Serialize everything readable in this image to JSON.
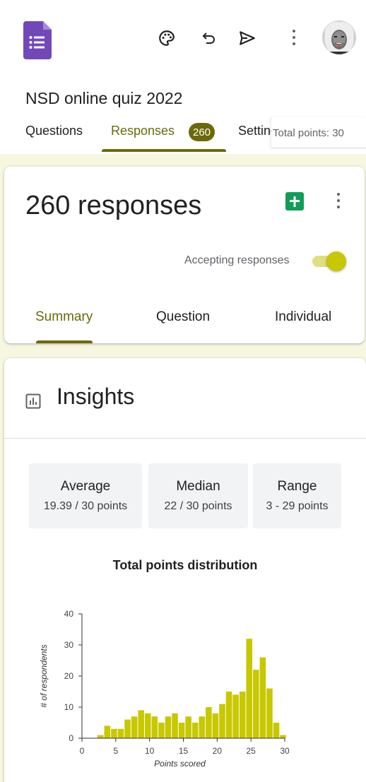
{
  "form": {
    "title": "NSD online quiz 2022"
  },
  "tabs": [
    {
      "label": "Questions"
    },
    {
      "label": "Responses",
      "badge": "260"
    },
    {
      "label": "Settings"
    }
  ],
  "total_points_label": "Total points: 30",
  "header_icons": [
    "palette-icon",
    "undo-icon",
    "send-icon",
    "more-vert-icon"
  ],
  "responses": {
    "count_label": "260 responses",
    "accepting_label": "Accepting responses",
    "accepting": true,
    "subtabs": [
      {
        "label": "Summary"
      },
      {
        "label": "Question"
      },
      {
        "label": "Individual"
      }
    ]
  },
  "insights": {
    "title": "Insights",
    "stats": [
      {
        "label": "Average",
        "value": "19.39 / 30 points"
      },
      {
        "label": "Median",
        "value": "22 / 30 points"
      },
      {
        "label": "Range",
        "value": "3 - 29 points"
      }
    ]
  },
  "colors": {
    "accent": "#6b6a0a",
    "bar": "#c8c800",
    "forms_purple": "#7248b9",
    "sheets_green": "#0f9d58"
  },
  "chart_data": {
    "type": "bar",
    "title": "Total points distribution",
    "xlabel": "Points scored",
    "ylabel": "# of respondents",
    "x": [
      3,
      4,
      5,
      6,
      7,
      8,
      9,
      10,
      11,
      12,
      13,
      14,
      15,
      16,
      17,
      18,
      19,
      20,
      21,
      22,
      23,
      24,
      25,
      26,
      27,
      28,
      29
    ],
    "values": [
      1,
      4,
      3,
      3,
      6,
      7,
      9,
      8,
      7,
      5,
      7,
      8,
      5,
      7,
      5,
      7,
      10,
      8,
      11,
      15,
      14,
      15,
      32,
      22,
      26,
      16,
      5,
      1
    ],
    "xlim": [
      0,
      30
    ],
    "ylim": [
      0,
      40
    ],
    "xticks": [
      0,
      5,
      10,
      15,
      20,
      25,
      30
    ],
    "yticks": [
      0,
      10,
      20,
      30,
      40
    ],
    "grid": false
  }
}
